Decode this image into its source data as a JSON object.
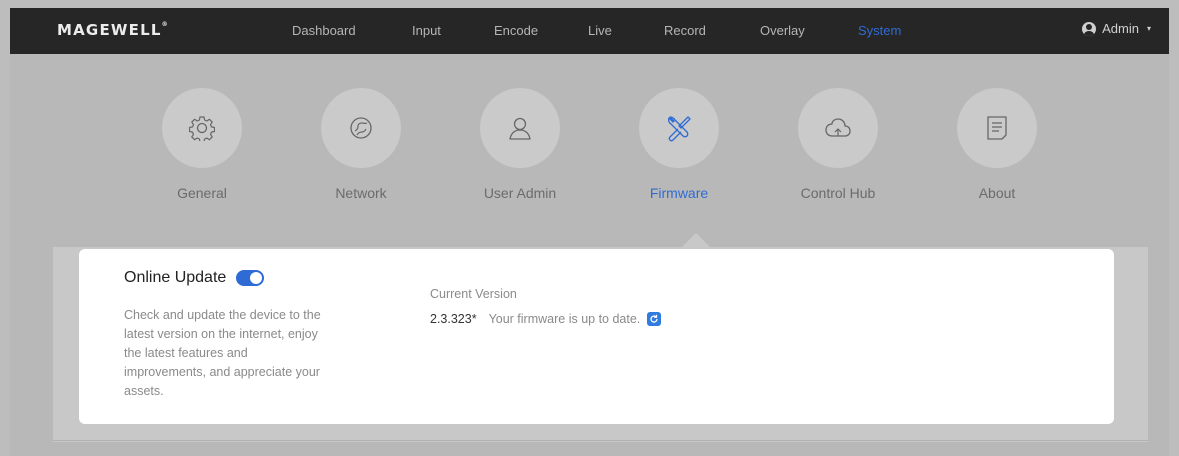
{
  "brand": {
    "name": "MAGEWELL",
    "mark": "®"
  },
  "nav": {
    "items": [
      {
        "label": "Dashboard",
        "active": false
      },
      {
        "label": "Input",
        "active": false
      },
      {
        "label": "Encode",
        "active": false
      },
      {
        "label": "Live",
        "active": false
      },
      {
        "label": "Record",
        "active": false
      },
      {
        "label": "Overlay",
        "active": false
      },
      {
        "label": "System",
        "active": true
      }
    ],
    "user": {
      "label": "Admin",
      "icon": "user-icon",
      "caret": "▾"
    }
  },
  "tabs": [
    {
      "label": "General",
      "icon": "gear-icon",
      "active": false
    },
    {
      "label": "Network",
      "icon": "network-icon",
      "active": false
    },
    {
      "label": "User Admin",
      "icon": "user-admin-icon",
      "active": false
    },
    {
      "label": "Firmware",
      "icon": "tools-icon",
      "active": true
    },
    {
      "label": "Control Hub",
      "icon": "cloud-icon",
      "active": false
    },
    {
      "label": "About",
      "icon": "document-icon",
      "active": false
    }
  ],
  "online_update": {
    "title": "Online Update",
    "enabled": true,
    "description": "Check and update the device to the latest version on the internet, enjoy the latest features and improvements, and appreciate your assets.",
    "current_version_label": "Current Version",
    "version": "2.3.323*",
    "status": "Your firmware is up to date."
  },
  "colors": {
    "accent": "#2f6bd4",
    "navbar": "#262626"
  }
}
